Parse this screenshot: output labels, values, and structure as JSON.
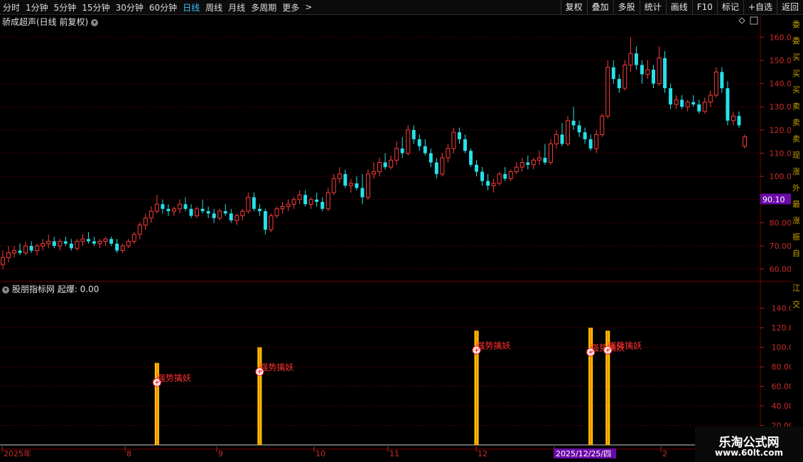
{
  "toolbar": {
    "periods": [
      "分时",
      "1分钟",
      "5分钟",
      "15分钟",
      "30分钟",
      "60分钟",
      "日线",
      "周线",
      "月线",
      "多周期",
      "更多"
    ],
    "active_period": "日线",
    "more_arrow": ">",
    "right_buttons": [
      "复权",
      "叠加",
      "多股",
      "统计",
      "画线",
      "F10",
      "标记",
      "+自选",
      "返回"
    ]
  },
  "main_panel": {
    "title": "骄成超声(日线 前复权)",
    "current_price_tag": "90.10",
    "y_ticks": [
      "160.0",
      "150.0",
      "140.0",
      "130.0",
      "120.0",
      "110.0",
      "100.0",
      "90.00",
      "80.00",
      "70.00",
      "60.00"
    ]
  },
  "indicator_panel": {
    "title": "股朋指标网 起爆: 0.00",
    "y_ticks": [
      "140.0",
      "120.0",
      "100.0",
      "80.00",
      "60.00",
      "40.00",
      "20.00"
    ],
    "signal_label": "强势擒妖"
  },
  "x_axis": {
    "labels": [
      "2025年",
      "8",
      "9",
      "10",
      "11",
      "12",
      "2025/12/25/四",
      "2"
    ]
  },
  "right_strip_chars": [
    "委",
    "委",
    "买",
    "买",
    "买",
    "卖",
    "卖",
    "卖",
    "现",
    "涨",
    "外",
    "最",
    "涨",
    "振",
    "自",
    "江",
    "交"
  ],
  "watermark": {
    "line1": "乐淘公式网",
    "line2": "www.60lt.com"
  },
  "colors": {
    "up": "#ff3b3b",
    "down": "#27e0ea",
    "grid": "#5a0000",
    "axis_text": "#cc2b2b",
    "signal": "#ffd200",
    "signal_core": "#ff7a00"
  },
  "chart_data": {
    "type": "candlestick",
    "series": [
      {
        "o": 62,
        "h": 68,
        "l": 60,
        "c": 65
      },
      {
        "o": 65,
        "h": 70,
        "l": 63,
        "c": 67
      },
      {
        "o": 67,
        "h": 70,
        "l": 65,
        "c": 68
      },
      {
        "o": 68,
        "h": 71,
        "l": 66,
        "c": 67
      },
      {
        "o": 67,
        "h": 72,
        "l": 66,
        "c": 70
      },
      {
        "o": 70,
        "h": 72,
        "l": 67,
        "c": 68
      },
      {
        "o": 68,
        "h": 71,
        "l": 66,
        "c": 70
      },
      {
        "o": 70,
        "h": 73,
        "l": 68,
        "c": 71
      },
      {
        "o": 71,
        "h": 75,
        "l": 69,
        "c": 72
      },
      {
        "o": 72,
        "h": 74,
        "l": 69,
        "c": 70
      },
      {
        "o": 70,
        "h": 73,
        "l": 68,
        "c": 72
      },
      {
        "o": 72,
        "h": 74,
        "l": 70,
        "c": 71
      },
      {
        "o": 71,
        "h": 73,
        "l": 68,
        "c": 69
      },
      {
        "o": 69,
        "h": 73,
        "l": 68,
        "c": 72
      },
      {
        "o": 72,
        "h": 75,
        "l": 70,
        "c": 73
      },
      {
        "o": 73,
        "h": 76,
        "l": 71,
        "c": 72
      },
      {
        "o": 72,
        "h": 74,
        "l": 70,
        "c": 71
      },
      {
        "o": 71,
        "h": 73,
        "l": 69,
        "c": 72
      },
      {
        "o": 72,
        "h": 74,
        "l": 70,
        "c": 73
      },
      {
        "o": 73,
        "h": 74,
        "l": 70,
        "c": 71
      },
      {
        "o": 71,
        "h": 73,
        "l": 67,
        "c": 68
      },
      {
        "o": 68,
        "h": 71,
        "l": 67,
        "c": 70
      },
      {
        "o": 70,
        "h": 73,
        "l": 69,
        "c": 72
      },
      {
        "o": 72,
        "h": 76,
        "l": 71,
        "c": 75
      },
      {
        "o": 75,
        "h": 80,
        "l": 73,
        "c": 79
      },
      {
        "o": 79,
        "h": 84,
        "l": 77,
        "c": 82
      },
      {
        "o": 82,
        "h": 87,
        "l": 80,
        "c": 85
      },
      {
        "o": 85,
        "h": 92,
        "l": 84,
        "c": 88
      },
      {
        "o": 88,
        "h": 90,
        "l": 84,
        "c": 86
      },
      {
        "o": 86,
        "h": 88,
        "l": 83,
        "c": 85
      },
      {
        "o": 85,
        "h": 87,
        "l": 83,
        "c": 86
      },
      {
        "o": 86,
        "h": 90,
        "l": 84,
        "c": 88
      },
      {
        "o": 88,
        "h": 91,
        "l": 85,
        "c": 86
      },
      {
        "o": 86,
        "h": 88,
        "l": 82,
        "c": 83
      },
      {
        "o": 83,
        "h": 87,
        "l": 82,
        "c": 86
      },
      {
        "o": 86,
        "h": 90,
        "l": 84,
        "c": 85
      },
      {
        "o": 85,
        "h": 87,
        "l": 82,
        "c": 84
      },
      {
        "o": 84,
        "h": 86,
        "l": 80,
        "c": 82
      },
      {
        "o": 82,
        "h": 86,
        "l": 81,
        "c": 85
      },
      {
        "o": 85,
        "h": 88,
        "l": 83,
        "c": 84
      },
      {
        "o": 84,
        "h": 86,
        "l": 80,
        "c": 81
      },
      {
        "o": 81,
        "h": 84,
        "l": 79,
        "c": 83
      },
      {
        "o": 83,
        "h": 86,
        "l": 81,
        "c": 85
      },
      {
        "o": 85,
        "h": 93,
        "l": 84,
        "c": 91
      },
      {
        "o": 91,
        "h": 93,
        "l": 85,
        "c": 86
      },
      {
        "o": 86,
        "h": 88,
        "l": 83,
        "c": 85
      },
      {
        "o": 85,
        "h": 86,
        "l": 75,
        "c": 77
      },
      {
        "o": 77,
        "h": 84,
        "l": 76,
        "c": 83
      },
      {
        "o": 83,
        "h": 87,
        "l": 82,
        "c": 86
      },
      {
        "o": 86,
        "h": 89,
        "l": 84,
        "c": 87
      },
      {
        "o": 87,
        "h": 90,
        "l": 85,
        "c": 88
      },
      {
        "o": 88,
        "h": 91,
        "l": 86,
        "c": 90
      },
      {
        "o": 90,
        "h": 94,
        "l": 88,
        "c": 92
      },
      {
        "o": 92,
        "h": 94,
        "l": 87,
        "c": 88
      },
      {
        "o": 88,
        "h": 91,
        "l": 86,
        "c": 90
      },
      {
        "o": 90,
        "h": 93,
        "l": 87,
        "c": 89
      },
      {
        "o": 89,
        "h": 91,
        "l": 85,
        "c": 86
      },
      {
        "o": 86,
        "h": 95,
        "l": 85,
        "c": 93
      },
      {
        "o": 93,
        "h": 101,
        "l": 92,
        "c": 99
      },
      {
        "o": 99,
        "h": 104,
        "l": 97,
        "c": 101
      },
      {
        "o": 101,
        "h": 103,
        "l": 95,
        "c": 96
      },
      {
        "o": 96,
        "h": 99,
        "l": 93,
        "c": 97
      },
      {
        "o": 97,
        "h": 100,
        "l": 94,
        "c": 95
      },
      {
        "o": 95,
        "h": 101,
        "l": 88,
        "c": 91
      },
      {
        "o": 91,
        "h": 103,
        "l": 90,
        "c": 101
      },
      {
        "o": 101,
        "h": 106,
        "l": 99,
        "c": 102
      },
      {
        "o": 102,
        "h": 108,
        "l": 100,
        "c": 106
      },
      {
        "o": 106,
        "h": 110,
        "l": 103,
        "c": 104
      },
      {
        "o": 104,
        "h": 109,
        "l": 103,
        "c": 107
      },
      {
        "o": 107,
        "h": 115,
        "l": 105,
        "c": 112
      },
      {
        "o": 112,
        "h": 117,
        "l": 108,
        "c": 110
      },
      {
        "o": 110,
        "h": 122,
        "l": 109,
        "c": 120
      },
      {
        "o": 120,
        "h": 122,
        "l": 114,
        "c": 116
      },
      {
        "o": 116,
        "h": 118,
        "l": 111,
        "c": 113
      },
      {
        "o": 113,
        "h": 116,
        "l": 109,
        "c": 110
      },
      {
        "o": 110,
        "h": 112,
        "l": 104,
        "c": 106
      },
      {
        "o": 106,
        "h": 108,
        "l": 99,
        "c": 101
      },
      {
        "o": 101,
        "h": 110,
        "l": 100,
        "c": 108
      },
      {
        "o": 108,
        "h": 114,
        "l": 106,
        "c": 112
      },
      {
        "o": 112,
        "h": 121,
        "l": 110,
        "c": 119
      },
      {
        "o": 119,
        "h": 121,
        "l": 114,
        "c": 116
      },
      {
        "o": 116,
        "h": 118,
        "l": 110,
        "c": 111
      },
      {
        "o": 111,
        "h": 112,
        "l": 104,
        "c": 105
      },
      {
        "o": 105,
        "h": 107,
        "l": 100,
        "c": 102
      },
      {
        "o": 102,
        "h": 104,
        "l": 96,
        "c": 98
      },
      {
        "o": 98,
        "h": 101,
        "l": 94,
        "c": 96
      },
      {
        "o": 96,
        "h": 99,
        "l": 93,
        "c": 97
      },
      {
        "o": 97,
        "h": 102,
        "l": 96,
        "c": 101
      },
      {
        "o": 101,
        "h": 104,
        "l": 98,
        "c": 99
      },
      {
        "o": 99,
        "h": 103,
        "l": 98,
        "c": 102
      },
      {
        "o": 102,
        "h": 106,
        "l": 101,
        "c": 104
      },
      {
        "o": 104,
        "h": 108,
        "l": 102,
        "c": 106
      },
      {
        "o": 106,
        "h": 109,
        "l": 103,
        "c": 105
      },
      {
        "o": 105,
        "h": 108,
        "l": 103,
        "c": 107
      },
      {
        "o": 107,
        "h": 111,
        "l": 105,
        "c": 108
      },
      {
        "o": 108,
        "h": 114,
        "l": 105,
        "c": 106
      },
      {
        "o": 106,
        "h": 116,
        "l": 105,
        "c": 114
      },
      {
        "o": 114,
        "h": 120,
        "l": 112,
        "c": 118
      },
      {
        "o": 118,
        "h": 123,
        "l": 113,
        "c": 114
      },
      {
        "o": 114,
        "h": 126,
        "l": 113,
        "c": 124
      },
      {
        "o": 124,
        "h": 130,
        "l": 120,
        "c": 122
      },
      {
        "o": 122,
        "h": 124,
        "l": 117,
        "c": 119
      },
      {
        "o": 119,
        "h": 121,
        "l": 114,
        "c": 116
      },
      {
        "o": 116,
        "h": 118,
        "l": 111,
        "c": 112
      },
      {
        "o": 112,
        "h": 120,
        "l": 110,
        "c": 118
      },
      {
        "o": 118,
        "h": 127,
        "l": 117,
        "c": 126
      },
      {
        "o": 126,
        "h": 150,
        "l": 125,
        "c": 147
      },
      {
        "o": 147,
        "h": 150,
        "l": 140,
        "c": 142
      },
      {
        "o": 142,
        "h": 144,
        "l": 136,
        "c": 138
      },
      {
        "o": 138,
        "h": 150,
        "l": 137,
        "c": 148
      },
      {
        "o": 148,
        "h": 160,
        "l": 145,
        "c": 153
      },
      {
        "o": 153,
        "h": 156,
        "l": 146,
        "c": 148
      },
      {
        "o": 148,
        "h": 150,
        "l": 140,
        "c": 144
      },
      {
        "o": 144,
        "h": 150,
        "l": 142,
        "c": 146
      },
      {
        "o": 146,
        "h": 148,
        "l": 138,
        "c": 140
      },
      {
        "o": 140,
        "h": 156,
        "l": 139,
        "c": 151
      },
      {
        "o": 151,
        "h": 154,
        "l": 136,
        "c": 138
      },
      {
        "o": 138,
        "h": 140,
        "l": 129,
        "c": 131
      },
      {
        "o": 131,
        "h": 135,
        "l": 129,
        "c": 133
      },
      {
        "o": 133,
        "h": 135,
        "l": 129,
        "c": 130
      },
      {
        "o": 130,
        "h": 133,
        "l": 128,
        "c": 132
      },
      {
        "o": 132,
        "h": 135,
        "l": 130,
        "c": 131
      },
      {
        "o": 131,
        "h": 133,
        "l": 127,
        "c": 128
      },
      {
        "o": 128,
        "h": 134,
        "l": 127,
        "c": 132
      },
      {
        "o": 132,
        "h": 137,
        "l": 130,
        "c": 135
      },
      {
        "o": 135,
        "h": 147,
        "l": 134,
        "c": 145
      },
      {
        "o": 145,
        "h": 147,
        "l": 136,
        "c": 138
      },
      {
        "o": 138,
        "h": 141,
        "l": 122,
        "c": 124
      },
      {
        "o": 124,
        "h": 128,
        "l": 122,
        "c": 126
      },
      {
        "o": 126,
        "h": 128,
        "l": 121,
        "c": 122
      },
      {
        "o": 113,
        "h": 118,
        "l": 112,
        "c": 117
      }
    ],
    "indicator_signals": [
      {
        "bar_index": 27,
        "value": 64
      },
      {
        "bar_index": 45,
        "value": 75
      },
      {
        "bar_index": 83,
        "value": 97
      },
      {
        "bar_index": 103,
        "value": 95
      },
      {
        "bar_index": 106,
        "value": 97
      }
    ],
    "main_ylim": [
      55,
      165
    ],
    "indicator_ylim": [
      0,
      155
    ]
  }
}
